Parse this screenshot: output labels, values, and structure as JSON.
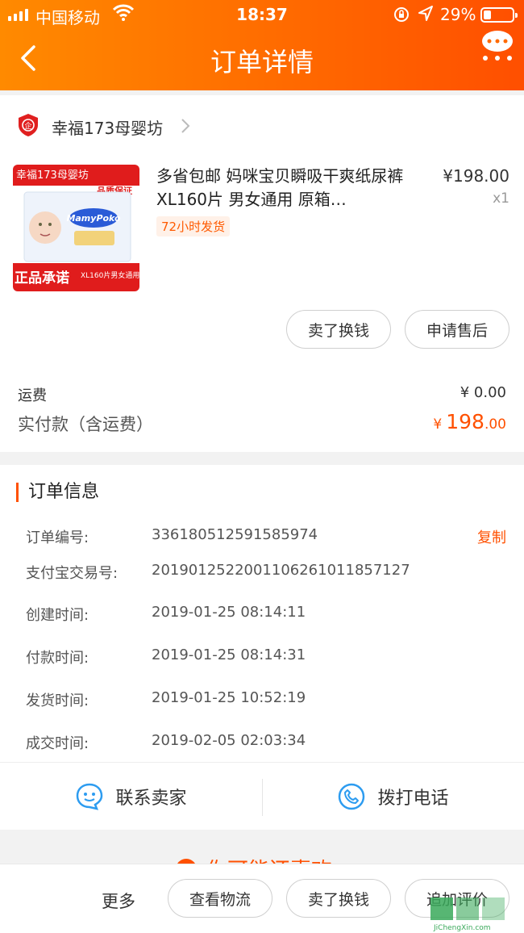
{
  "status_bar": {
    "carrier": "中国移动",
    "time": "18:37",
    "battery": "29%"
  },
  "header": {
    "title": "订单详情"
  },
  "shop": {
    "name": "幸福173母婴坊",
    "icon_text": "企"
  },
  "product": {
    "title": "多省包邮  妈咪宝贝瞬吸干爽纸尿裤XL160片 男女通用 原箱…",
    "tag": "72小时发货",
    "price": "¥198.00",
    "qty": "x1",
    "image": {
      "top_banner": "幸福173母婴坊",
      "quality": "品质保证",
      "brand": "MamyPoko",
      "bottom_banner": "正品承诺",
      "spec": "XL160片男女通用"
    }
  },
  "order_actions": {
    "sell_exchange": "卖了换钱",
    "after_sale": "申请售后"
  },
  "fees": {
    "shipping_label": "运费",
    "shipping_value": "¥ 0.00",
    "paid_label": "实付款（含运费）",
    "paid_currency": "¥",
    "paid_integer": "198",
    "paid_cents": ".00"
  },
  "order_info": {
    "title": "订单信息",
    "copy_label": "复制",
    "rows": [
      {
        "key": "订单编号:",
        "value": "336180512591585974"
      },
      {
        "key": "支付宝交易号:",
        "value": "2019012522001106261011857127"
      },
      {
        "key": "创建时间:",
        "value": "2019-01-25 08:14:11"
      },
      {
        "key": "付款时间:",
        "value": "2019-01-25 08:14:31"
      },
      {
        "key": "发货时间:",
        "value": "2019-01-25 10:52:19"
      },
      {
        "key": "成交时间:",
        "value": "2019-02-05 02:03:34"
      }
    ]
  },
  "contact": {
    "seller": "联系卖家",
    "call": "拨打电话"
  },
  "recommend": {
    "title": "你可能还喜欢"
  },
  "bottom_bar": {
    "more": "更多",
    "logistics": "查看物流",
    "sell_exchange": "卖了换钱",
    "add_review": "追加评价"
  },
  "watermark": {
    "text": "JiChengXin.com"
  },
  "colors": {
    "accent": "#ff5000",
    "header_start": "#ff8a00",
    "header_end": "#ff4f00"
  }
}
